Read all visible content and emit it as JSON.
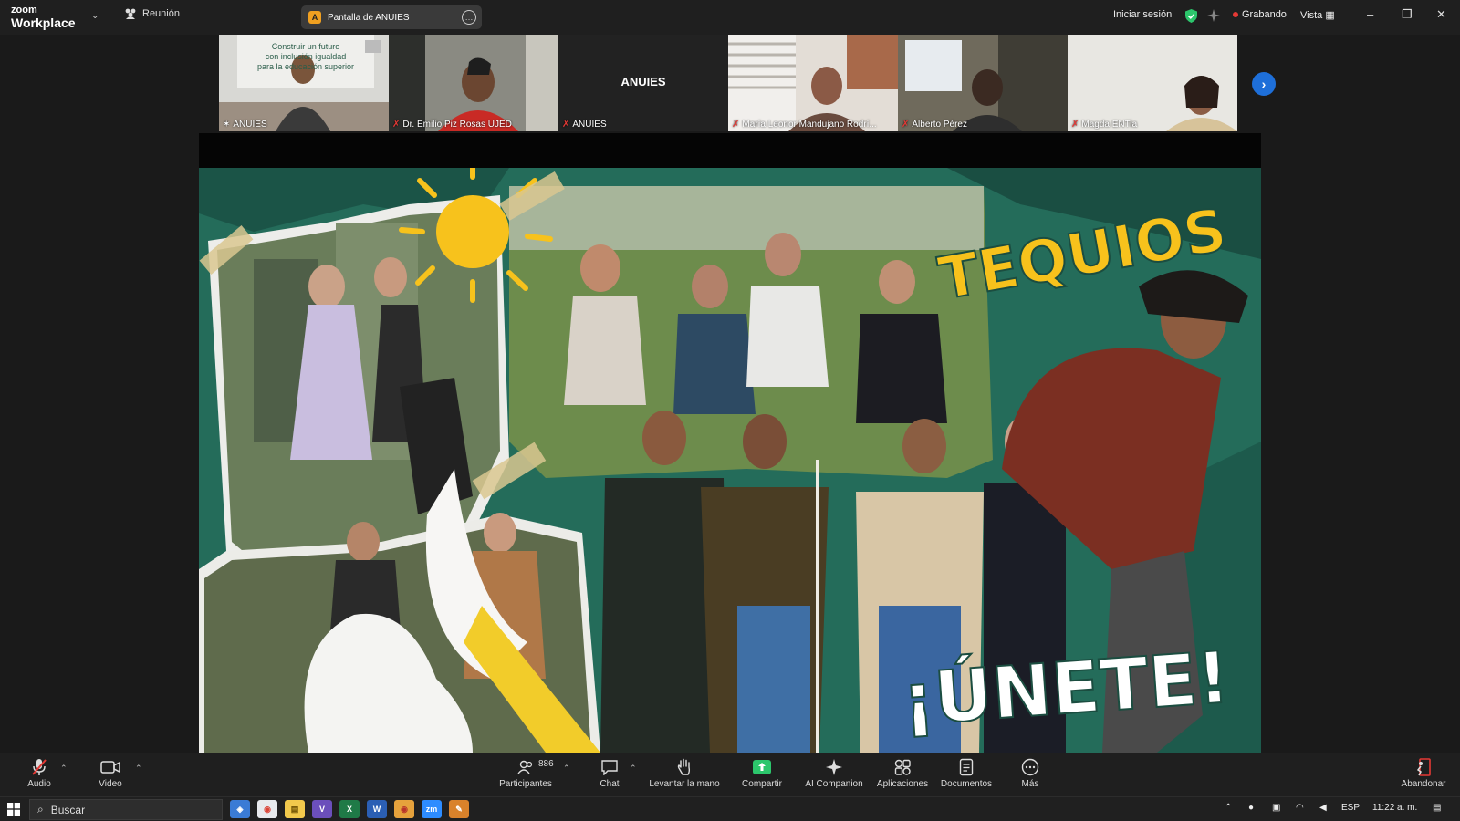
{
  "app": {
    "brand_line1": "zoom",
    "brand_line2": "Workplace",
    "meeting_label": "Reunión",
    "share_source": "Pantalla de ANUIES",
    "share_source_initial": "A",
    "sign_in": "Iniciar sesión",
    "recording": "Grabando",
    "view": "Vista"
  },
  "participants": [
    {
      "name": "ANUIES",
      "muted": false,
      "active": true,
      "center_text": ""
    },
    {
      "name": "Dr. Emilio Piz Rosas UJED",
      "muted": true,
      "active": false,
      "center_text": ""
    },
    {
      "name": "ANUIES",
      "muted": true,
      "active": false,
      "center_text": "ANUIES"
    },
    {
      "name": "María Leonor Mandujano Rodrí...",
      "muted": true,
      "active": false,
      "center_text": ""
    },
    {
      "name": "Alberto Pérez",
      "muted": true,
      "active": false,
      "center_text": ""
    },
    {
      "name": "Magda ENTia",
      "muted": true,
      "active": false,
      "center_text": ""
    }
  ],
  "tile0_banner": [
    "Construir un futuro",
    "con inclusión igualdad",
    "para la educación superior"
  ],
  "poster": {
    "headline": "TEQUIOS",
    "call": "¡ÚNETE!"
  },
  "toolbar": {
    "audio": "Audio",
    "video": "Video",
    "participants": "Participantes",
    "participants_count": "886",
    "chat": "Chat",
    "raise_hand": "Levantar la mano",
    "share": "Compartir",
    "ai_companion": "AI Companion",
    "apps": "Aplicaciones",
    "documents": "Documentos",
    "more": "Más",
    "leave": "Abandonar"
  },
  "taskbar": {
    "search_placeholder": "Buscar",
    "language": "ESP",
    "time": "11:22 a. m."
  },
  "colors": {
    "active_border": "#2cc66c",
    "recording": "#e53935",
    "share_green": "#2cc66c",
    "next_button": "#1e6fd9",
    "poster_teal": "#236b5a",
    "poster_yellow": "#f7c21c"
  }
}
